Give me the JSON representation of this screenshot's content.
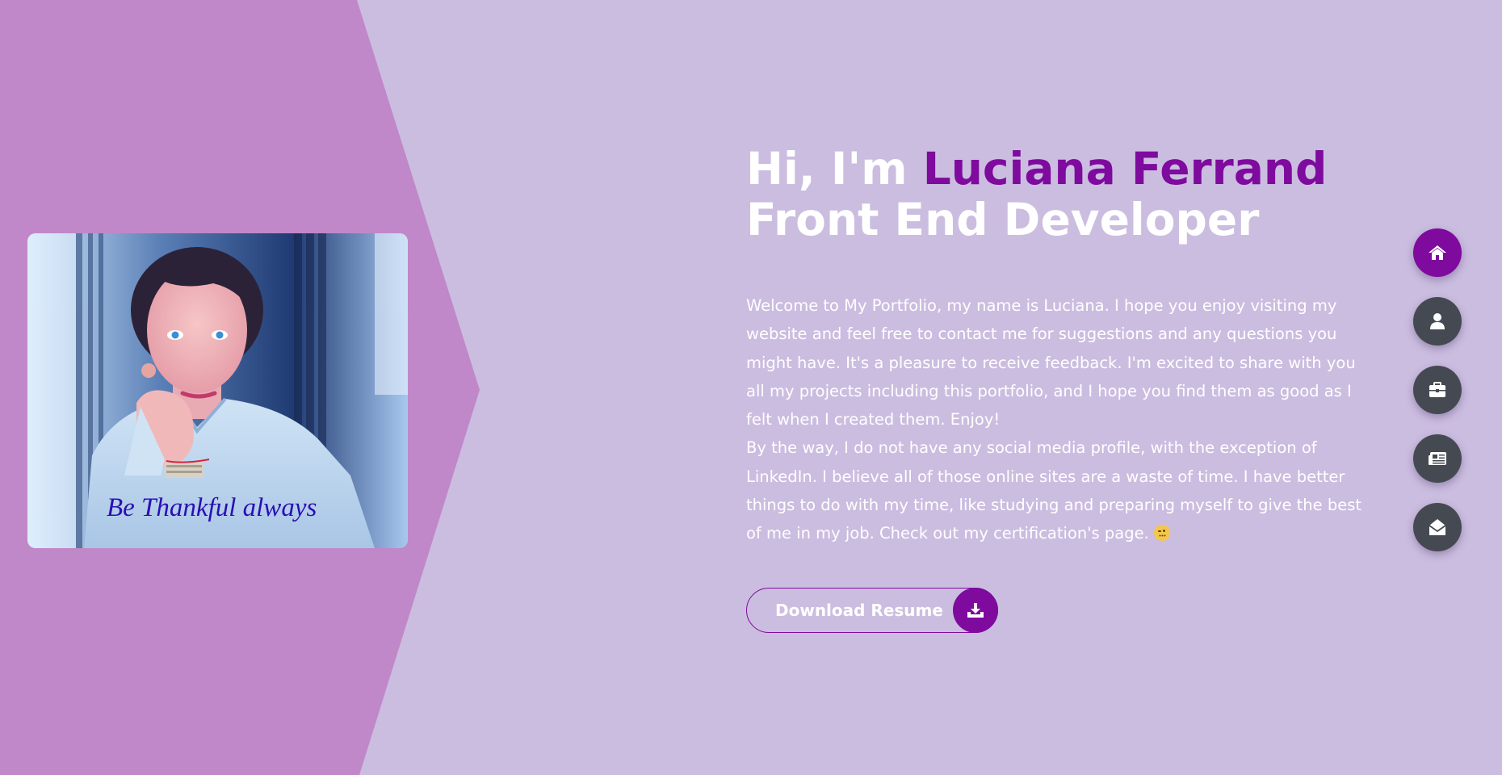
{
  "hero": {
    "greeting": "Hi, I'm ",
    "name": "Luciana Ferrand",
    "role": "Front End Developer",
    "paragraph_1": "Welcome to My Portfolio, my name is Luciana. I hope you enjoy visiting my website and feel free to contact me for suggestions and any questions you might have. It's a pleasure to receive feedback. I'm excited to share with you all my projects including this portfolio, and I hope you find them as good as I felt when I created them. Enjoy!",
    "paragraph_2": "By the way, I do not have any social media profile, with the exception of LinkedIn. I believe all of those online sites are a waste of time. I have better things to do with my time, like studying and preparing myself to give the best of me in my job. Check out my certification's page.",
    "emoji_icon": "winking-face-icon"
  },
  "photo": {
    "caption": "Be Thankful always"
  },
  "download": {
    "label": "Download Resume",
    "icon": "download-icon"
  },
  "nav": {
    "items": [
      {
        "icon": "home-icon",
        "active": true
      },
      {
        "icon": "user-icon",
        "active": false
      },
      {
        "icon": "briefcase-icon",
        "active": false
      },
      {
        "icon": "newspaper-icon",
        "active": false
      },
      {
        "icon": "envelope-open-icon",
        "active": false
      }
    ]
  },
  "colors": {
    "background": "#cbbde0",
    "left_panel": "#c088c8",
    "accent": "#7e0a9e",
    "nav_button": "#454a52",
    "text": "#ffffff"
  }
}
